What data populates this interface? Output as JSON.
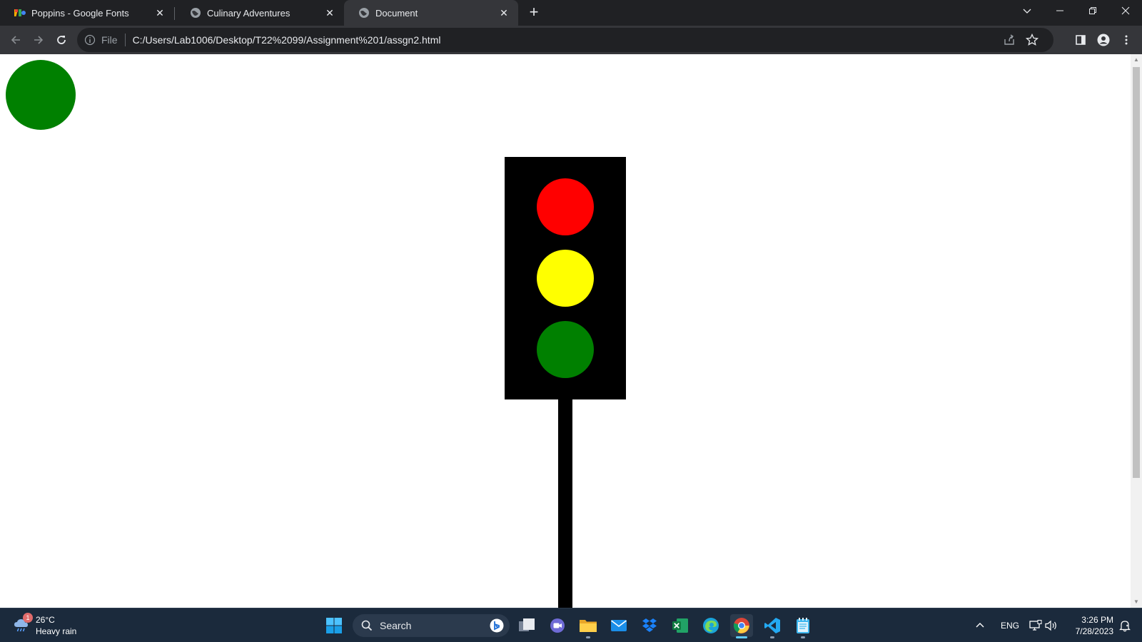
{
  "browser": {
    "tabs": [
      {
        "title": "Poppins - Google Fonts",
        "icon": "google-fonts-icon",
        "active": false
      },
      {
        "title": "Culinary Adventures",
        "icon": "globe-icon",
        "active": false
      },
      {
        "title": "Document",
        "icon": "globe-icon",
        "active": true
      }
    ],
    "address": {
      "scheme_label": "File",
      "url": "C:/Users/Lab1006/Desktop/T22%2099/Assignment%201/assgn2.html"
    }
  },
  "page": {
    "top_circle_color": "#008000",
    "traffic_light": {
      "housing_color": "#000000",
      "lights": [
        {
          "name": "red",
          "color": "#ff0000"
        },
        {
          "name": "yellow",
          "color": "#ffff00"
        },
        {
          "name": "green",
          "color": "#008000"
        }
      ]
    }
  },
  "taskbar": {
    "weather": {
      "temp": "26°C",
      "desc": "Heavy rain",
      "badge": "1"
    },
    "search_label": "Search",
    "language": "ENG",
    "clock": {
      "time": "3:26 PM",
      "date": "7/28/2023"
    }
  }
}
